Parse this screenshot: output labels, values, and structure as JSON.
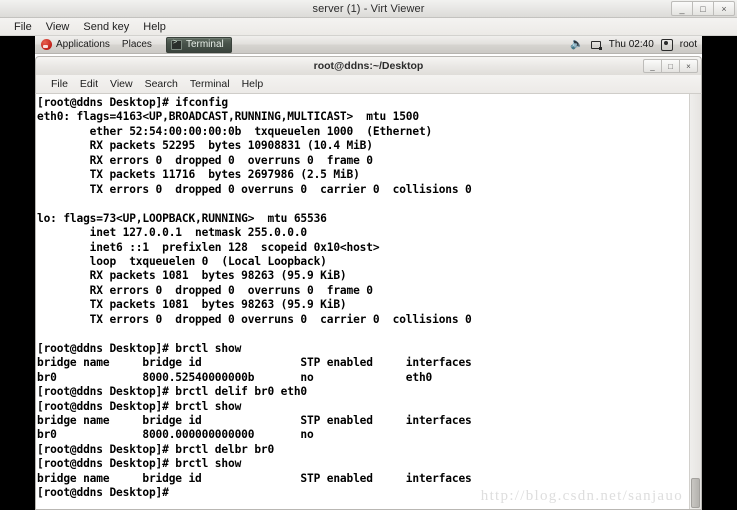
{
  "outer_window": {
    "title": "server (1) - Virt Viewer",
    "buttons": {
      "minimize": "_",
      "maximize": "□",
      "close": "×"
    },
    "menu": [
      "File",
      "View",
      "Send key",
      "Help"
    ]
  },
  "guest_panel": {
    "applications_label": "Applications",
    "places_label": "Places",
    "task_label": "Terminal",
    "clock": "Thu 02:40",
    "user": "root",
    "icons": {
      "fedora": "fedora-logo-icon",
      "terminal": "terminal-icon",
      "volume": "volume-icon",
      "network": "network-icon",
      "user": "user-icon"
    }
  },
  "terminal_window": {
    "title": "root@ddns:~/Desktop",
    "buttons": {
      "minimize": "_",
      "maximize": "□",
      "close": "×"
    },
    "menu": [
      "File",
      "Edit",
      "View",
      "Search",
      "Terminal",
      "Help"
    ],
    "watermark": "http://blog.csdn.net/sanjauo",
    "content": "[root@ddns Desktop]# ifconfig\neth0: flags=4163<UP,BROADCAST,RUNNING,MULTICAST>  mtu 1500\n        ether 52:54:00:00:00:0b  txqueuelen 1000  (Ethernet)\n        RX packets 52295  bytes 10908831 (10.4 MiB)\n        RX errors 0  dropped 0  overruns 0  frame 0\n        TX packets 11716  bytes 2697986 (2.5 MiB)\n        TX errors 0  dropped 0 overruns 0  carrier 0  collisions 0\n\nlo: flags=73<UP,LOOPBACK,RUNNING>  mtu 65536\n        inet 127.0.0.1  netmask 255.0.0.0\n        inet6 ::1  prefixlen 128  scopeid 0x10<host>\n        loop  txqueuelen 0  (Local Loopback)\n        RX packets 1081  bytes 98263 (95.9 KiB)\n        RX errors 0  dropped 0  overruns 0  frame 0\n        TX packets 1081  bytes 98263 (95.9 KiB)\n        TX errors 0  dropped 0 overruns 0  carrier 0  collisions 0\n\n[root@ddns Desktop]# brctl show\nbridge name     bridge id               STP enabled     interfaces\nbr0             8000.52540000000b       no              eth0\n[root@ddns Desktop]# brctl delif br0 eth0\n[root@ddns Desktop]# brctl show\nbridge name     bridge id               STP enabled     interfaces\nbr0             8000.000000000000       no\n[root@ddns Desktop]# brctl delbr br0\n[root@ddns Desktop]# brctl show\nbridge name     bridge id               STP enabled     interfaces\n[root@ddns Desktop]# "
  },
  "colors": {
    "terminal_bg": "#ffffff",
    "terminal_fg": "#000000",
    "chrome": "#ece9e6",
    "letterbox": "#000000",
    "watermark": "#dedede"
  }
}
